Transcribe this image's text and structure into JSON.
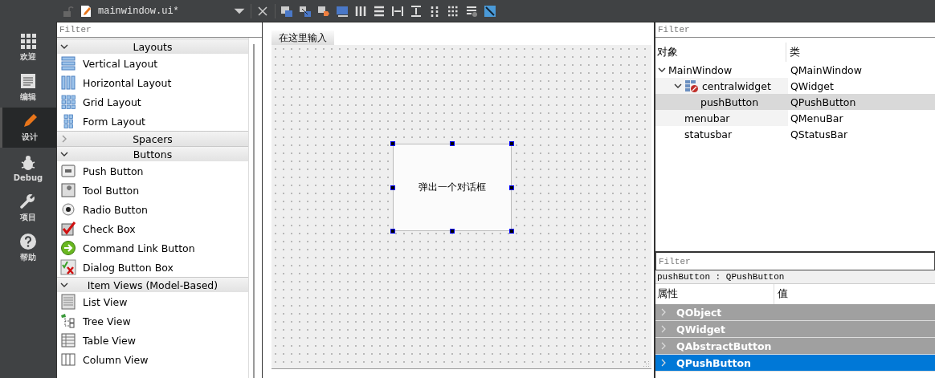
{
  "mode_bar": {
    "items": [
      {
        "label": "欢迎",
        "selected": false
      },
      {
        "label": "编辑",
        "selected": false
      },
      {
        "label": "设计",
        "selected": true
      },
      {
        "label": "Debug",
        "selected": false
      },
      {
        "label": "项目",
        "selected": false
      },
      {
        "label": "帮助",
        "selected": false
      }
    ]
  },
  "editor_toolbar": {
    "file_name": "mainwindow.ui*",
    "locked": false
  },
  "widget_box": {
    "filter": {
      "placeholder": "Filter"
    },
    "categories": [
      {
        "title": "Layouts",
        "expanded": true,
        "items": [
          "Vertical Layout",
          "Horizontal Layout",
          "Grid Layout",
          "Form Layout"
        ]
      },
      {
        "title": "Spacers",
        "expanded": false
      },
      {
        "title": "Buttons",
        "expanded": true,
        "items": [
          "Push Button",
          "Tool Button",
          "Radio Button",
          "Check Box",
          "Command Link Button",
          "Dialog Button Box"
        ]
      },
      {
        "title": "Item Views (Model-Based)",
        "expanded": true,
        "items": [
          "List View",
          "Tree View",
          "Table View",
          "Column View"
        ]
      }
    ]
  },
  "form": {
    "menu_bar": [
      "在这里输入"
    ],
    "push_button": {
      "text": "弹出一个对话框",
      "selected": true
    }
  },
  "object_inspector": {
    "filter": {
      "placeholder": "Filter"
    },
    "columns": [
      "对象",
      "类"
    ],
    "tree": [
      {
        "name": "MainWindow",
        "class": "QMainWindow",
        "expanded": true,
        "selected": false,
        "children": [
          {
            "name": "centralwidget",
            "class": "QWidget",
            "expanded": true,
            "selected": false,
            "children": [
              {
                "name": "pushButton",
                "class": "QPushButton",
                "selected": true
              }
            ]
          },
          {
            "name": "menubar",
            "class": "QMenuBar",
            "selected": false
          },
          {
            "name": "statusbar",
            "class": "QStatusBar",
            "selected": false
          }
        ]
      }
    ]
  },
  "property_editor": {
    "filter": {
      "placeholder": "Filter"
    },
    "object_label": "pushButton : QPushButton",
    "columns": [
      "属性",
      "值"
    ],
    "groups": [
      {
        "name": "QObject",
        "expanded": false,
        "selected": false
      },
      {
        "name": "QWidget",
        "expanded": false,
        "selected": false
      },
      {
        "name": "QAbstractButton",
        "expanded": false,
        "selected": false
      },
      {
        "name": "QPushButton",
        "expanded": false,
        "selected": true
      }
    ]
  }
}
